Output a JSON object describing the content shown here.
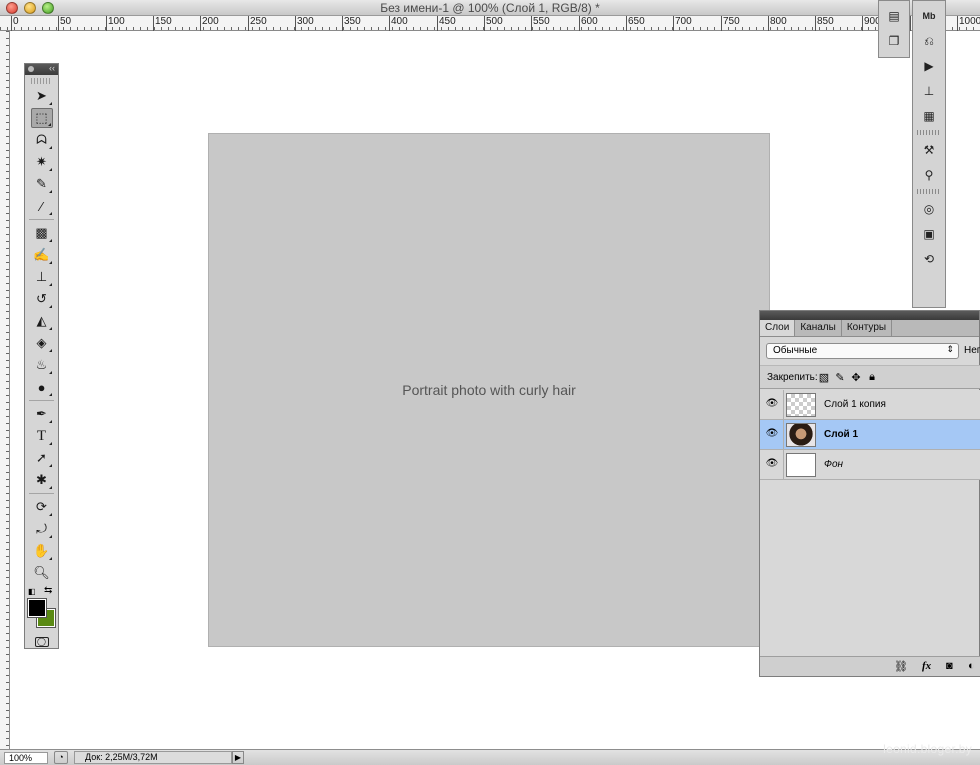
{
  "window": {
    "title": "Без имени-1 @ 100% (Слой 1, RGB/8) *"
  },
  "ruler": {
    "labels": [
      "0",
      "50",
      "100",
      "150",
      "200",
      "250",
      "300",
      "350",
      "400",
      "450",
      "500",
      "550",
      "600",
      "650",
      "700",
      "750",
      "800",
      "850",
      "900",
      "950",
      "1000"
    ]
  },
  "canvas": {
    "photo_alt": "Portrait photo with curly hair"
  },
  "layers_panel": {
    "tabs": [
      "Слои",
      "Каналы",
      "Контуры"
    ],
    "active_tab": "Слои",
    "blend_mode": "Обычные",
    "opacity_label": "Неп",
    "lock_label": "Закрепить:",
    "layers": [
      {
        "name": "Слой 1 копия",
        "selected": false,
        "visible": true
      },
      {
        "name": "Слой 1",
        "selected": true,
        "visible": true
      },
      {
        "name": "Фон",
        "selected": false,
        "visible": true
      }
    ],
    "footer_fx": "fx"
  },
  "statusbar": {
    "zoom": "100%",
    "doc_size": "Док: 2,25M/3,72M"
  },
  "watermark": "leonid.bloger.by",
  "tools": {
    "fg_color": "#000000",
    "bg_color": "#5a8a14"
  },
  "icons": {
    "tools": [
      "move-icon",
      "marquee-icon",
      "lasso-icon",
      "magic-wand-icon",
      "crop-icon",
      "eyedropper-icon",
      "healing-icon",
      "brush-icon",
      "stamp-icon",
      "history-brush-icon",
      "eraser-icon",
      "paint-bucket-icon",
      "blur-icon",
      "dodge-icon",
      "pen-icon",
      "type-icon",
      "path-select-icon",
      "shape-icon",
      "3d-rotate-icon",
      "3d-orbit-icon",
      "hand-icon",
      "zoom-icon"
    ],
    "dock": [
      "mini-bridge-icon",
      "history-icon",
      "actions-icon",
      "animation-icon",
      "measurement-icon",
      "tool-presets-icon",
      "brushes-icon",
      "3d-icon",
      "clone-source-icon",
      "navigator-icon"
    ]
  }
}
